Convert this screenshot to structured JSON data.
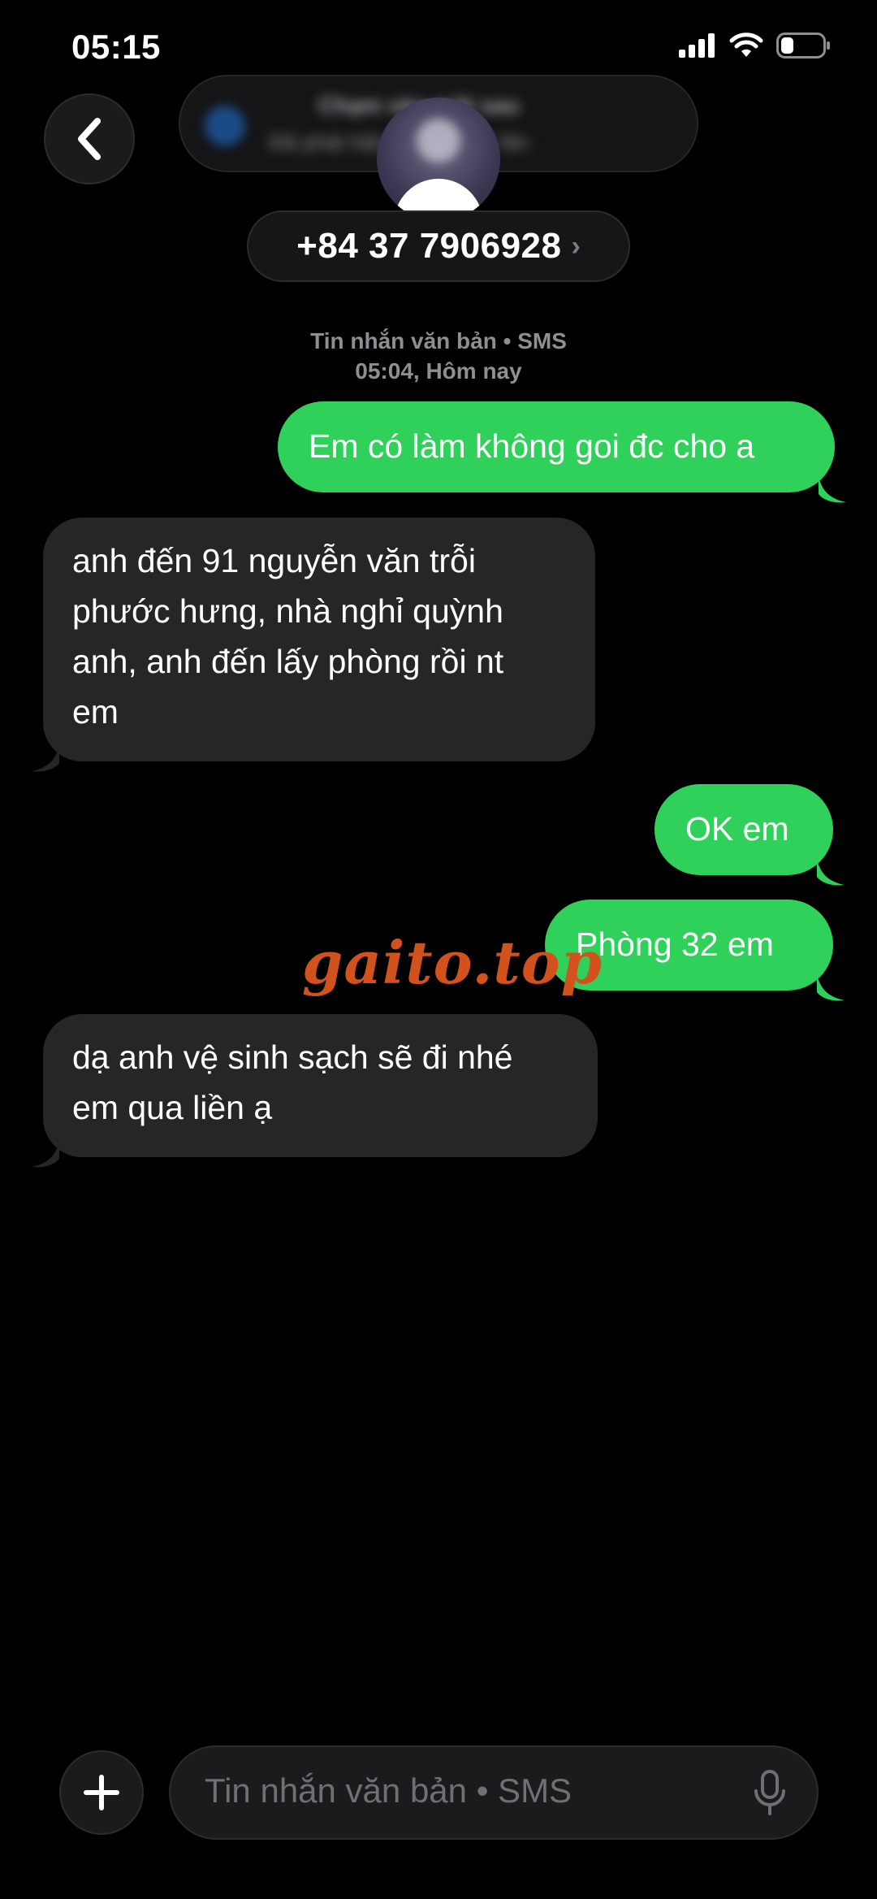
{
  "status_bar": {
    "time": "05:15",
    "battery_level": 0.3
  },
  "header": {
    "banner": {
      "line1": "Chạm vào mặt sau",
      "line2": "Đã phát hiện liên lạc hai lần"
    },
    "contact": "+84 37 7906928",
    "contact_chevron": "›"
  },
  "meta": {
    "type": "Tin nhắn văn bản • SMS",
    "time": "05:04, Hôm nay"
  },
  "messages": [
    {
      "direction": "sent",
      "lines": [
        "Em có làm không goi đc cho a"
      ]
    },
    {
      "direction": "received",
      "lines": [
        "anh đến 91 nguyễn văn trỗi",
        "phước hưng, nhà nghỉ quỳnh",
        "anh, anh đến lấy phòng rồi nt",
        "em"
      ]
    },
    {
      "direction": "sent",
      "lines": [
        "OK em"
      ]
    },
    {
      "direction": "sent",
      "lines": [
        "Phòng 32 em"
      ]
    },
    {
      "direction": "received",
      "lines": [
        "dạ anh vệ sinh sạch sẽ đi nhé",
        "em qua liền ạ"
      ]
    }
  ],
  "watermark": "gaito.top",
  "input": {
    "placeholder": "Tin nhắn văn bản • SMS"
  },
  "colors": {
    "sent_bubble": "#2fd15a",
    "received_bubble": "#262628",
    "background": "#000000",
    "watermark": "#d2521e"
  },
  "icons": [
    "back-chevron-icon",
    "signal-icon",
    "wifi-icon",
    "battery-icon",
    "plus-icon",
    "microphone-icon"
  ]
}
